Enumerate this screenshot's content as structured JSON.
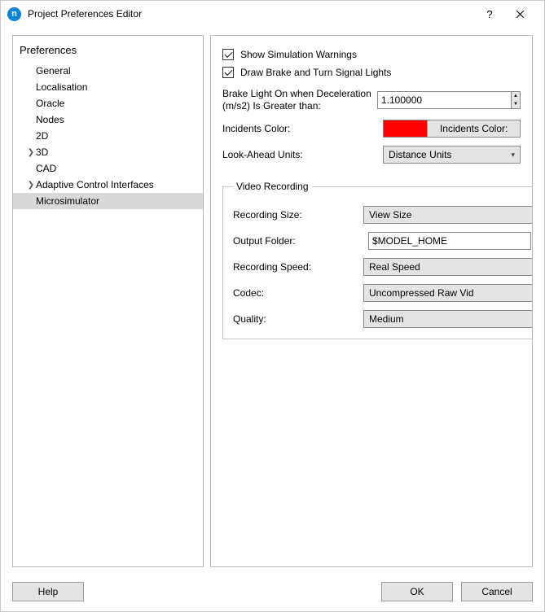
{
  "window": {
    "title": "Project Preferences Editor",
    "icon_letter": "n"
  },
  "sidebar": {
    "header": "Preferences",
    "items": [
      {
        "label": "General",
        "expandable": false
      },
      {
        "label": "Localisation",
        "expandable": false
      },
      {
        "label": "Oracle",
        "expandable": false
      },
      {
        "label": "Nodes",
        "expandable": false
      },
      {
        "label": "2D",
        "expandable": false
      },
      {
        "label": "3D",
        "expandable": true
      },
      {
        "label": "CAD",
        "expandable": false
      },
      {
        "label": "Adaptive Control Interfaces",
        "expandable": true
      },
      {
        "label": "Microsimulator",
        "expandable": false,
        "selected": true
      }
    ]
  },
  "main": {
    "show_warnings": {
      "checked": true,
      "label": "Show Simulation Warnings"
    },
    "draw_lights": {
      "checked": true,
      "label": "Draw Brake and Turn Signal Lights"
    },
    "brake_label": "Brake Light On when Deceleration (m/s2) Is Greater than:",
    "brake_value": "1.100000",
    "incidents_label": "Incidents Color:",
    "incidents_button_label": "Incidents Color:",
    "incidents_color": "#ff0000",
    "look_ahead_label": "Look-Ahead Units:",
    "look_ahead_value": "Distance Units",
    "video": {
      "legend": "Video Recording",
      "rec_size_label": "Recording Size:",
      "rec_size_value": "View Size",
      "out_folder_label": "Output Folder:",
      "out_folder_value": "$MODEL_HOME",
      "browse_label": "...",
      "rec_speed_label": "Recording Speed:",
      "rec_speed_value": "Real Speed",
      "codec_label": "Codec:",
      "codec_value": "Uncompressed Raw Vid",
      "quality_label": "Quality:",
      "quality_value": "Medium"
    }
  },
  "footer": {
    "help": "Help",
    "ok": "OK",
    "cancel": "Cancel"
  }
}
